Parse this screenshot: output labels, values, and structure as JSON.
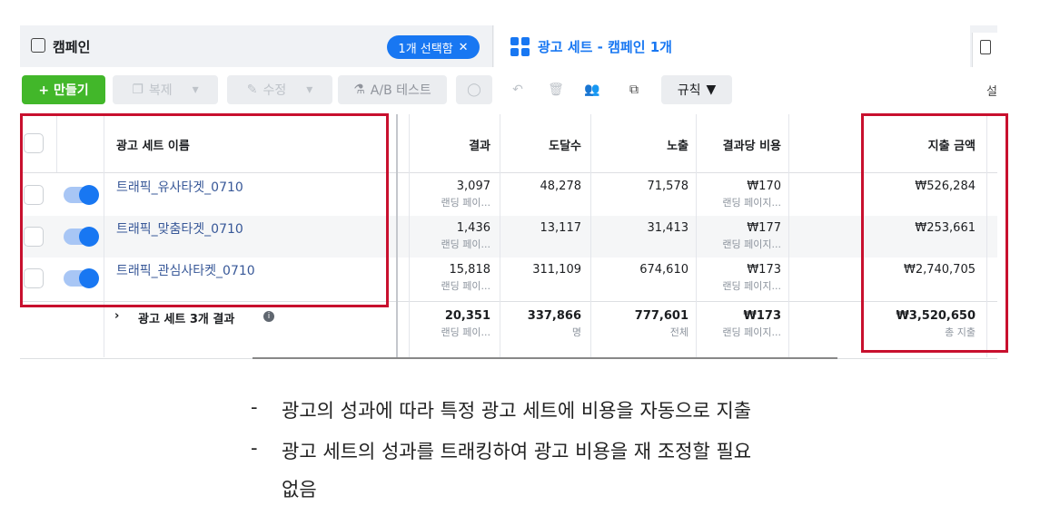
{
  "tabs": {
    "campaign_label": "캠페인",
    "selected_badge": "1개 선택함",
    "adset_label": "광고 세트 - 캠페인 1개"
  },
  "toolbar": {
    "create": "+ 만들기",
    "duplicate": "복제",
    "edit": "수정",
    "ab_test": "A/B 테스트",
    "rules": "규칙",
    "settings_partial": "설"
  },
  "table": {
    "headers": {
      "name": "광고 세트 이름",
      "results": "결과",
      "reach": "도달수",
      "impressions": "노출",
      "cost_per_result": "결과당 비용",
      "amount_spent": "지출 금액"
    },
    "rows": [
      {
        "name": "트래픽_유사타겟_0710",
        "results": "3,097",
        "results_sub": "랜딩 페이...",
        "reach": "48,278",
        "impressions": "71,578",
        "cpr": "₩170",
        "cpr_sub": "랜딩 페이지...",
        "spent": "₩526,284"
      },
      {
        "name": "트래픽_맞춤타겟_0710",
        "results": "1,436",
        "results_sub": "랜딩 페이...",
        "reach": "13,117",
        "impressions": "31,413",
        "cpr": "₩177",
        "cpr_sub": "랜딩 페이지...",
        "spent": "₩253,661"
      },
      {
        "name": "트래픽_관심사타켓_0710",
        "results": "15,818",
        "results_sub": "랜딩 페이...",
        "reach": "311,109",
        "impressions": "674,610",
        "cpr": "₩173",
        "cpr_sub": "랜딩 페이지...",
        "spent": "₩2,740,705"
      }
    ],
    "summary": {
      "label": "광고 세트 3개 결과",
      "results": "20,351",
      "results_sub": "랜딩 페이...",
      "reach": "337,866",
      "reach_sub": "명",
      "impressions": "777,601",
      "impressions_sub": "전체",
      "cpr": "₩173",
      "cpr_sub": "랜딩 페이지...",
      "spent": "₩3,520,650",
      "spent_sub": "총 지출"
    }
  },
  "notes": {
    "line1": "광고의 성과에 따라 특정 광고 세트에 비용을 자동으로 지출",
    "line2": "광고 세트의 성과를 트래킹하여 광고 비용을 재 조정할 필요",
    "line3": "없음"
  },
  "colors": {
    "accent": "#1877f2",
    "create": "#42b72a",
    "highlight": "#c8102e"
  }
}
